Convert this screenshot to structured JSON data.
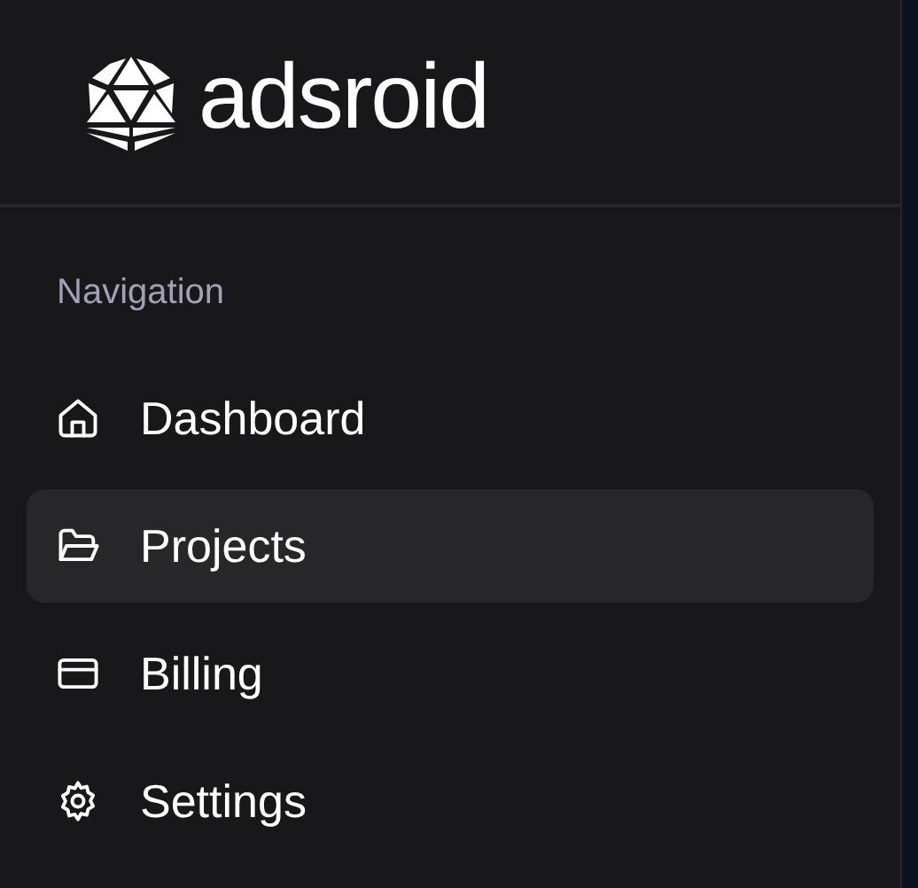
{
  "brand": {
    "name": "adsroid"
  },
  "navigation": {
    "heading": "Navigation",
    "items": [
      {
        "label": "Dashboard",
        "selected": false
      },
      {
        "label": "Projects",
        "selected": true
      },
      {
        "label": "Billing",
        "selected": false
      },
      {
        "label": "Settings",
        "selected": false
      }
    ]
  }
}
